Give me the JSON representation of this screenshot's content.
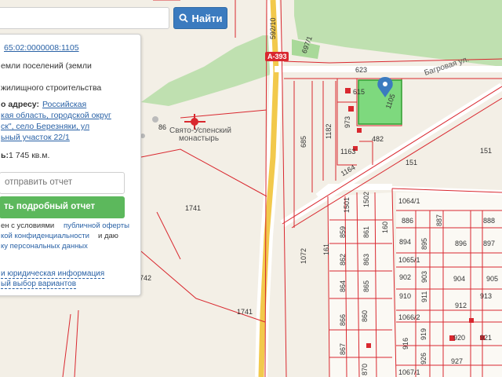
{
  "search": {
    "placeholder": "",
    "button_label": "Найти"
  },
  "panel": {
    "cadastral_number": "65:02:0000008:1105",
    "category_line1": "емли поселений (земли",
    "usage": "жилищного строительства",
    "address_label": "о адресу:",
    "address_line1": "Российская",
    "address_line2": "кая область, городской округ",
    "address_line3": "ск\", село Березняки, ул",
    "address_line4": "ьный участок 22/1",
    "area_label": "ь:",
    "area_value": "1 745 кв.м.",
    "send_placeholder": "отправить отчет",
    "report_button": "ть подробный отчет",
    "consent_line1_prefix": "ен с условиями",
    "consent_offer_link": "публичной оферты",
    "consent_line2": "кой конфиденциальности",
    "consent_line2_suffix": "и даю",
    "consent_line3": "ку персональных данных",
    "legal_link": "и юридическая информация",
    "choice_link": "ый выбор вариантов"
  },
  "map": {
    "road_shield": "А-393",
    "street_label": "Багровая ул.",
    "poi_label_line1": "Свято-Успенский",
    "poi_label_line2": "монастырь",
    "parcels": {
      "p592_10": "592/10",
      "p697_1": "697/1",
      "p623": "623",
      "p615": "615",
      "p1105": "1105",
      "p973": "973",
      "p1182": "1182",
      "p685": "685",
      "p482": "482",
      "p1163": "1163",
      "p1164": "1164",
      "p151a": "151",
      "p151b": "151",
      "p86": "86",
      "p1741a": "1741",
      "p1741b": "1741",
      "p742": "742",
      "p1501": "1501",
      "p1502": "1502",
      "p1064_1": "1064/1",
      "p886": "886",
      "p887": "887",
      "p888": "888",
      "p859": "859",
      "p861": "861",
      "p160": "160",
      "p894": "894",
      "p895": "895",
      "p896": "896",
      "p897": "897",
      "p161": "161",
      "p1072": "1072",
      "p862": "862",
      "p863": "863",
      "p1065_1": "1065/1",
      "p902": "902",
      "p903": "903",
      "p904": "904",
      "p905": "905",
      "p864": "864",
      "p865": "865",
      "p910": "910",
      "p911": "911",
      "p912": "912",
      "p913": "913",
      "p1066_2": "1066/2",
      "p866": "866",
      "p860": "860",
      "p916": "916",
      "p919": "919",
      "p920": "920",
      "p921": "921",
      "p867": "867",
      "p926": "926",
      "p927": "927",
      "p870": "870",
      "p1067_1": "1067/1"
    }
  },
  "colors": {
    "background": "#f3efe6",
    "forest": "#bfe0b0",
    "selected_parcel": "#7ed97e",
    "boundary": "#d9282f",
    "highway": "#f2c94c",
    "marker": "#3b7bbf",
    "report_button": "#5cb85c",
    "search_button": "#3b7bbf"
  }
}
